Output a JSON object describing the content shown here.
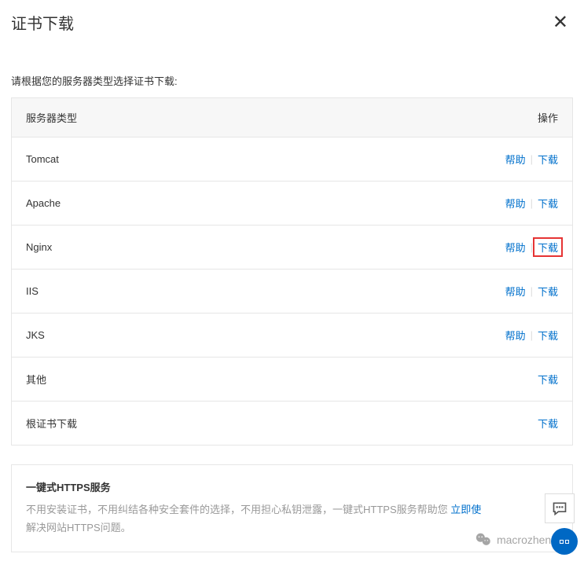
{
  "header": {
    "title": "证书下载"
  },
  "instruction": "请根据您的服务器类型选择证书下载:",
  "table": {
    "header_left": "服务器类型",
    "header_right": "操作",
    "help_label": "帮助",
    "download_label": "下载",
    "rows": [
      {
        "label": "Tomcat",
        "has_help": true,
        "highlighted": false
      },
      {
        "label": "Apache",
        "has_help": true,
        "highlighted": false
      },
      {
        "label": "Nginx",
        "has_help": true,
        "highlighted": true
      },
      {
        "label": "IIS",
        "has_help": true,
        "highlighted": false
      },
      {
        "label": "JKS",
        "has_help": true,
        "highlighted": false
      },
      {
        "label": "其他",
        "has_help": false,
        "highlighted": false
      },
      {
        "label": "根证书下载",
        "has_help": false,
        "highlighted": false
      }
    ]
  },
  "promo": {
    "title": "一键式HTTPS服务",
    "text_before": "不用安装证书，不用纠结各种安全套件的选择，不用担心私钥泄露，一键式HTTPS服务帮助您 ",
    "link": "立即使",
    "text_after": "解决网站HTTPS问题。"
  },
  "wechat": {
    "name": "macrozheng"
  }
}
